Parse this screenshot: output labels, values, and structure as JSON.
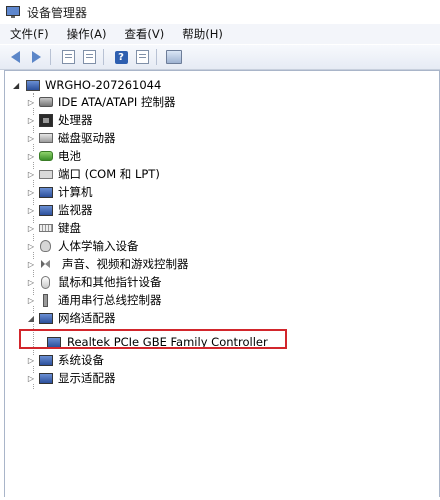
{
  "window": {
    "title": "设备管理器",
    "app_icon": "device-manager-icon"
  },
  "menubar": {
    "items": [
      "文件(F)",
      "操作(A)",
      "查看(V)",
      "帮助(H)"
    ]
  },
  "toolbar": {
    "buttons": [
      {
        "icon": "back-arrow-icon"
      },
      {
        "icon": "forward-arrow-icon"
      },
      {
        "icon": "properties-icon"
      },
      {
        "icon": "details-icon"
      },
      {
        "icon": "help-icon",
        "text": "?"
      },
      {
        "icon": "view-icon"
      },
      {
        "icon": "scan-hardware-icon"
      }
    ]
  },
  "tree": {
    "root": {
      "label": "WRGHO-207261044",
      "expander": "◢",
      "icon": "computer-icon"
    },
    "nodes": [
      {
        "label": "IDE ATA/ATAPI 控制器",
        "icon": "ide-controller-icon"
      },
      {
        "label": "处理器",
        "icon": "processor-icon"
      },
      {
        "label": "磁盘驱动器",
        "icon": "disk-drive-icon"
      },
      {
        "label": "电池",
        "icon": "battery-icon"
      },
      {
        "label": "端口 (COM 和 LPT)",
        "icon": "port-icon"
      },
      {
        "label": "计算机",
        "icon": "computer-icon"
      },
      {
        "label": "监视器",
        "icon": "monitor-icon"
      },
      {
        "label": "键盘",
        "icon": "keyboard-icon"
      },
      {
        "label": "人体学输入设备",
        "icon": "hid-icon"
      },
      {
        "label": "声音、视频和游戏控制器",
        "icon": "sound-icon"
      },
      {
        "label": "鼠标和其他指针设备",
        "icon": "mouse-icon"
      },
      {
        "label": "通用串行总线控制器",
        "icon": "usb-icon"
      },
      {
        "label": "网络适配器",
        "icon": "network-adapter-icon",
        "expanded": true
      },
      {
        "label": "系统设备",
        "icon": "system-device-icon"
      },
      {
        "label": "显示适配器",
        "icon": "display-adapter-icon"
      }
    ],
    "collapsed_expander": "▷",
    "expanded_expander": "◢",
    "network_child": {
      "label": "Realtek PCIe GBE Family Controller",
      "icon": "network-card-icon"
    }
  },
  "colors": {
    "highlight": "#d2262c",
    "accent": "#2c4f9b"
  }
}
